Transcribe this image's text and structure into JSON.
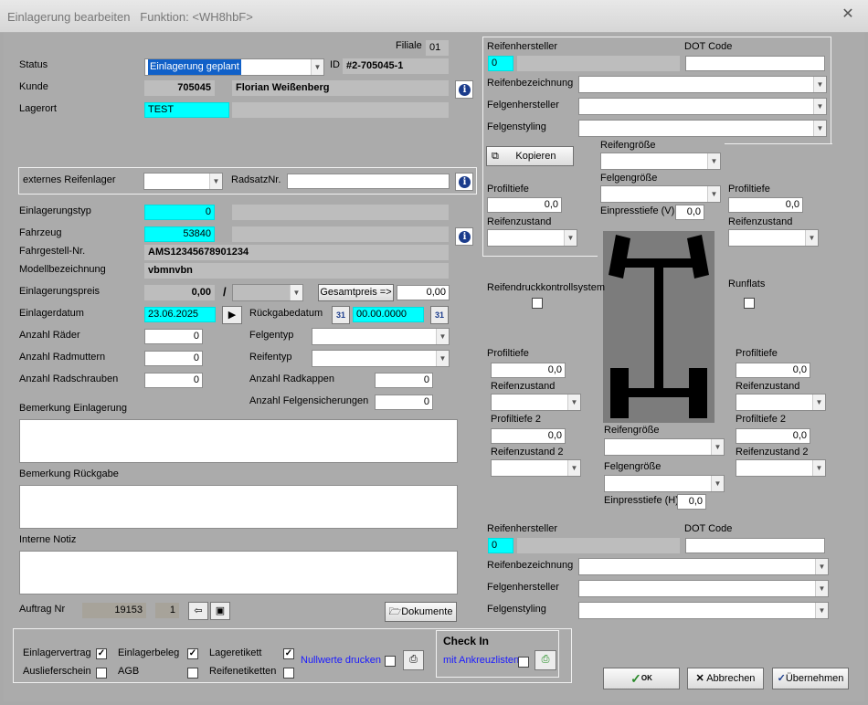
{
  "window": {
    "title": "Einlagerung bearbeiten",
    "function": "Funktion: <WH8hbF>",
    "close_glyph": "✕"
  },
  "left": {
    "filiale_label": "Filiale",
    "filiale_value": "01",
    "status_label": "Status",
    "status_value": "Einlagerung geplant",
    "id_label": "ID",
    "id_value": "#2-705045-1",
    "kunde_label": "Kunde",
    "kunde_nr": "705045",
    "kunde_name": "Florian Weißenberg",
    "lagerort_label": "Lagerort",
    "lagerort_value": "TEST",
    "ext_lager_label": "externes Reifenlager",
    "radsatz_label": "RadsatzNr.",
    "einlagerungstyp_label": "Einlagerungstyp",
    "einlagerungstyp_value": "0",
    "fahrzeug_label": "Fahrzeug",
    "fahrzeug_value": "53840",
    "fahrgestell_label": "Fahrgestell-Nr.",
    "fahrgestell_value": "AMS12345678901234",
    "modell_label": "Modellbezeichnung",
    "modell_value": "vbmnvbn",
    "preis_label": "Einlagerungspreis",
    "preis_value": "0,00",
    "preis_sep": "/",
    "gesamtpreis_button": "Gesamtpreis =>",
    "gesamtpreis_value": "0,00",
    "einlagerdatum_label": "Einlagerdatum",
    "einlagerdatum_value": "23.06.2025",
    "rueckgabe_label": "Rückgabedatum",
    "rueckgabe_value": "00.00.0000",
    "cal_day": "31",
    "raeder_label": "Anzahl Räder",
    "raeder_value": "0",
    "radmuttern_label": "Anzahl Radmuttern",
    "radmuttern_value": "0",
    "radschrauben_label": "Anzahl Radschrauben",
    "radschrauben_value": "0",
    "felgentyp_label": "Felgentyp",
    "reifentyp_label": "Reifentyp",
    "radkappen_label": "Anzahl Radkappen",
    "radkappen_value": "0",
    "felgensich_label": "Anzahl Felgensicherungen",
    "felgensich_value": "0",
    "bem_einlagerung_label": "Bemerkung Einlagerung",
    "bem_rueckgabe_label": "Bemerkung Rückgabe",
    "interne_notiz_label": "Interne Notiz",
    "auftrag_label": "Auftrag Nr",
    "auftrag_nr": "19153",
    "auftrag_pos": "1",
    "dokumente_button": "Dokumente"
  },
  "right": {
    "front": {
      "hersteller_label": "Reifenhersteller",
      "hersteller_value": "0",
      "dot_label": "DOT Code",
      "bezeichnung_label": "Reifenbezeichnung",
      "felgenhersteller_label": "Felgenhersteller",
      "felgenstyling_label": "Felgenstyling",
      "kopieren_button": "Kopieren",
      "reifengroesse_label": "Reifengröße",
      "felgengroesse_label": "Felgengröße",
      "einpress_label": "Einpresstiefe (V)",
      "einpress_value": "0,0",
      "left_profil_label": "Profiltiefe",
      "left_profil_value": "0,0",
      "left_zustand_label": "Reifenzustand",
      "right_profil_label": "Profiltiefe",
      "right_profil_value": "0,0",
      "right_zustand_label": "Reifenzustand"
    },
    "rdks_label": "Reifendruckkontrollsystem",
    "runflats_label": "Runflats",
    "rear": {
      "left_profil_label": "Profiltiefe",
      "left_profil_value": "0,0",
      "left_zustand_label": "Reifenzustand",
      "left_profil2_label": "Profiltiefe 2",
      "left_profil2_value": "0,0",
      "left_zustand2_label": "Reifenzustand 2",
      "right_profil_label": "Profiltiefe",
      "right_profil_value": "0,0",
      "right_zustand_label": "Reifenzustand",
      "right_profil2_label": "Profiltiefe 2",
      "right_profil2_value": "0,0",
      "right_zustand2_label": "Reifenzustand 2",
      "reifengroesse_label": "Reifengröße",
      "felgengroesse_label": "Felgengröße",
      "einpress_label": "Einpresstiefe (H)",
      "einpress_value": "0,0",
      "hersteller_label": "Reifenhersteller",
      "hersteller_value": "0",
      "dot_label": "DOT Code",
      "bezeichnung_label": "Reifenbezeichnung",
      "felgenhersteller_label": "Felgenhersteller",
      "felgenstyling_label": "Felgenstyling"
    }
  },
  "bottom": {
    "einlagervertrag": "Einlagervertrag",
    "einlagerbeleg": "Einlagerbeleg",
    "lageretikett": "Lageretikett",
    "auslieferschein": "Auslieferschein",
    "agb": "AGB",
    "reifenetiketten": "Reifenetiketten",
    "nullwerte": "Nullwerte drucken",
    "checkin_title": "Check In",
    "ankreuz": "mit Ankreuzlisten",
    "ok_label": "OK",
    "abbrechen": "Abbrechen",
    "uebernehmen": "Übernehmen",
    "check_mark": "✓"
  },
  "colors": {
    "cyan_field": "#00ffff",
    "selected_blue": "#1060c8",
    "link_blue": "#1a1aff"
  }
}
